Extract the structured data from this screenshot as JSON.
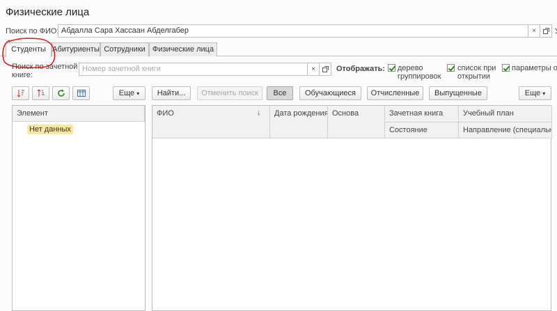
{
  "window": {
    "title": "Физические лица"
  },
  "search": {
    "label": "Поиск по ФИО:",
    "value": "Абдалла Сара Хассаан Абделгабер",
    "trailing_label": "У"
  },
  "tabs": [
    {
      "label": "Студенты",
      "active": true
    },
    {
      "label": "Абитуриенты",
      "active": false
    },
    {
      "label": "Сотрудники",
      "active": false
    },
    {
      "label": "Физические лица",
      "active": false
    }
  ],
  "record_book": {
    "label_line1": "Поиск по зачетной",
    "label_line2": "книге:",
    "placeholder": "Номер зачетной книги"
  },
  "display": {
    "label": "Отображать:",
    "options": [
      {
        "line1": "дерево",
        "line2": "группировок",
        "checked": true
      },
      {
        "line1": "список при",
        "line2": "открытии",
        "checked": true
      },
      {
        "line1": "параметры от",
        "line2": "",
        "checked": true
      }
    ]
  },
  "left_toolbar": {
    "more_label": "Еще",
    "icons": [
      "sort-ascending-icon",
      "sort-descending-icon",
      "refresh-icon",
      "table-settings-icon"
    ]
  },
  "main_toolbar": {
    "find_label": "Найти...",
    "cancel_search_label": "Отменить поиск",
    "filters": [
      "Все",
      "Обучающиеся",
      "Отчисленные",
      "Выпущенные"
    ],
    "more_label": "Еще"
  },
  "tree": {
    "header": "Элемент",
    "empty_text": "Нет данных"
  },
  "grid": {
    "columns_row1": [
      "ФИО",
      "Дата рождения",
      "Основа",
      "Зачетная книга",
      "Учебный план"
    ],
    "columns_row2": [
      "Состояние",
      "Направление (специальность)"
    ],
    "sort_indicator": "↓"
  },
  "annotation": {
    "color": "#e0231c"
  },
  "colors": {
    "checkbox_mark": "#2f8a1e",
    "empty_highlight": "#fbe7a0"
  }
}
